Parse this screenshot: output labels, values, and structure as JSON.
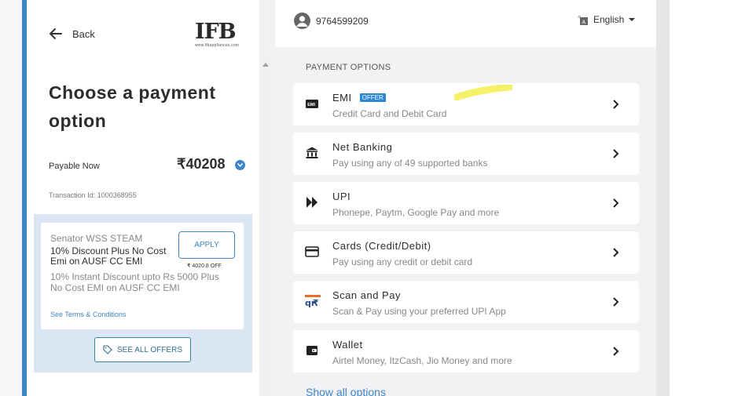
{
  "left": {
    "back_label": "Back",
    "logo": {
      "text": "IFB",
      "sub": "www.ifbappliances.com"
    },
    "title": "Choose a payment option",
    "payable_label": "Payable Now",
    "payable_amount": "₹40208",
    "transaction": "Transaction Id: 1000368955",
    "offer": {
      "name": "Senator WSS STEAM",
      "headline": "10% Discount Plus No Cost Emi on AUSF CC EMI",
      "description": "10% Instant Discount upto Rs 5000 Plus No Cost EMI on AUSF CC EMI",
      "terms": "See Terms & Conditions",
      "apply_label": "APPLY",
      "off_text": "₹ 4020.8 OFF"
    },
    "see_all_offers": "SEE ALL OFFERS",
    "accent_color": "#3e86c8"
  },
  "header": {
    "phone": "9764599209",
    "language": "English"
  },
  "section_title": "PAYMENT OPTIONS",
  "options": [
    {
      "title": "EMI",
      "badge": "OFFER",
      "subtitle": "Credit Card and Debit Card",
      "icon": "emi-icon"
    },
    {
      "title": "Net Banking",
      "subtitle": "Pay using any of 49 supported banks",
      "icon": "bank-icon"
    },
    {
      "title": "UPI",
      "subtitle": "Phonepe, Paytm, Google Pay and more",
      "icon": "upi-icon"
    },
    {
      "title": "Cards (Credit/Debit)",
      "subtitle": "Pay using any credit or debit card",
      "icon": "card-icon"
    },
    {
      "title": "Scan and Pay",
      "subtitle": "Scan & Pay using your preferred UPI App",
      "icon": "scan-pay-icon"
    },
    {
      "title": "Wallet",
      "subtitle": "Airtel Money, ItzCash, Jio Money and more",
      "icon": "wallet-icon"
    }
  ],
  "show_all": "Show all options"
}
